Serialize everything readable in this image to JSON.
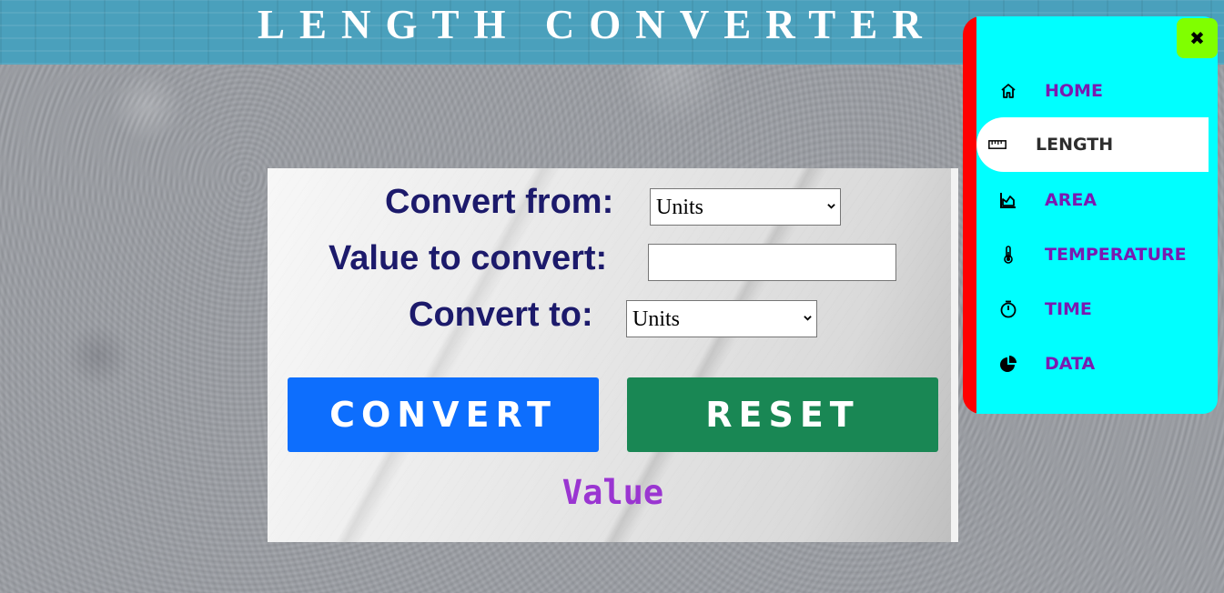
{
  "header": {
    "title": "LENGTH CONVERTER"
  },
  "form": {
    "from_label": "Convert from:",
    "from_selected": "Units",
    "value_label": "Value to convert:",
    "value_input": "",
    "to_label": "Convert to:",
    "to_selected": "Units"
  },
  "buttons": {
    "convert_label": "CONVERT",
    "reset_label": "RESET"
  },
  "result": {
    "text": "Value"
  },
  "sidenav": {
    "close_glyph": "✖",
    "items": [
      {
        "label": "HOME",
        "icon": "home-icon",
        "active": false
      },
      {
        "label": "LENGTH",
        "icon": "ruler-icon",
        "active": true
      },
      {
        "label": "AREA",
        "icon": "area-chart-icon",
        "active": false
      },
      {
        "label": "TEMPERATURE",
        "icon": "thermometer-icon",
        "active": false
      },
      {
        "label": "TIME",
        "icon": "stopwatch-icon",
        "active": false
      },
      {
        "label": "DATA",
        "icon": "pie-chart-icon",
        "active": false
      }
    ]
  },
  "colors": {
    "header_bg": "#4aa0bc",
    "label_text": "#1c1a6b",
    "convert_button": "#0d6efd",
    "reset_button": "#198754",
    "result_text": "#9a35d1",
    "sidenav_bg": "#00ffff",
    "sidenav_border": "#ff0000",
    "close_button": "#80ff00",
    "nav_text": "#7a1ab0"
  }
}
